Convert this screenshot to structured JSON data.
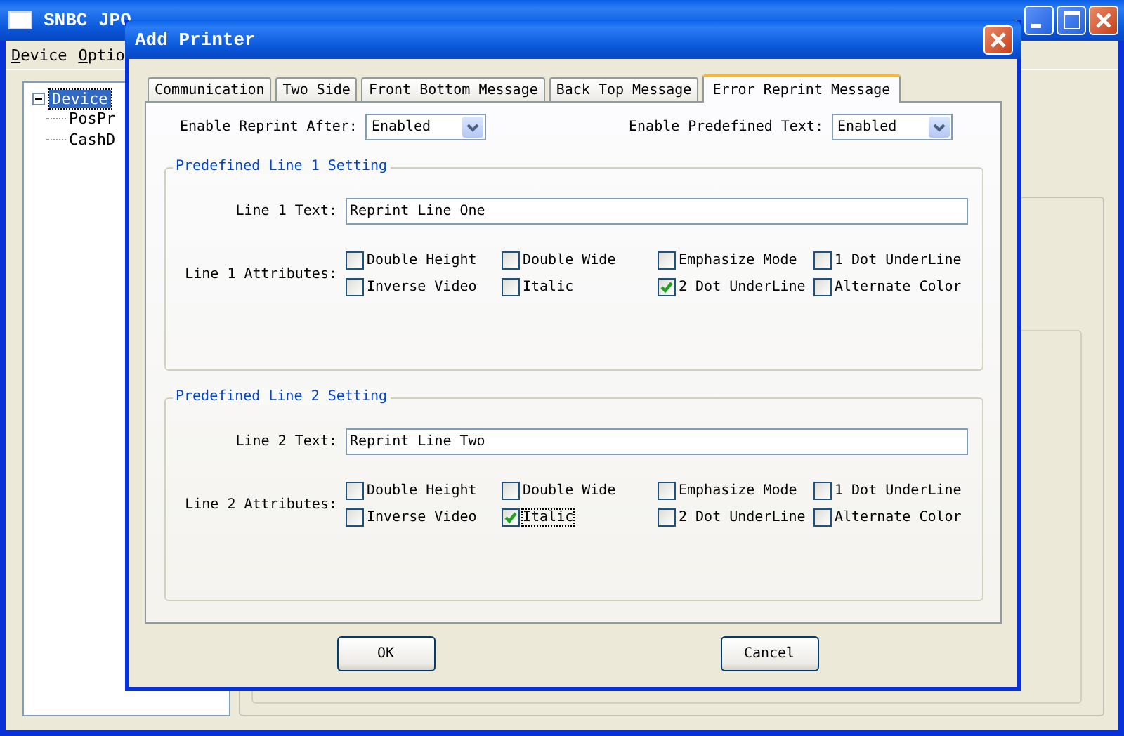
{
  "main_window": {
    "title": "SNBC JPO",
    "menu": [
      "Device",
      "Optio"
    ],
    "tree": [
      {
        "label": "Device",
        "selected": true,
        "expanded": true,
        "children": [
          {
            "label": "PosPr",
            "selected": false
          },
          {
            "label": "CashD",
            "selected": false
          }
        ]
      }
    ]
  },
  "dialog": {
    "title": "Add Printer",
    "tabs": [
      {
        "label": "Communication",
        "selected": false
      },
      {
        "label": "Two Side",
        "selected": false
      },
      {
        "label": "Front Bottom Message",
        "selected": false
      },
      {
        "label": "Back Top Message",
        "selected": false
      },
      {
        "label": "Error Reprint Message",
        "selected": true
      }
    ],
    "enable_reprint_after": {
      "label": "Enable Reprint After:",
      "value": "Enabled"
    },
    "enable_predefined_text": {
      "label": "Enable Predefined Text:",
      "value": "Enabled"
    },
    "groups": [
      {
        "title": "Predefined Line 1 Setting",
        "text_label": "Line 1 Text:",
        "text_value": "Reprint Line One",
        "attributes_label": "Line 1 Attributes:",
        "attributes": [
          {
            "label": "Double Height",
            "checked": false,
            "focused": false
          },
          {
            "label": "Double Wide",
            "checked": false,
            "focused": false
          },
          {
            "label": "Emphasize Mode",
            "checked": false,
            "focused": false
          },
          {
            "label": "1 Dot UnderLine",
            "checked": false,
            "focused": false
          },
          {
            "label": "Inverse Video",
            "checked": false,
            "focused": false
          },
          {
            "label": "Italic",
            "checked": false,
            "focused": false
          },
          {
            "label": "2 Dot UnderLine",
            "checked": true,
            "focused": false
          },
          {
            "label": "Alternate Color",
            "checked": false,
            "focused": false
          }
        ]
      },
      {
        "title": "Predefined Line 2 Setting",
        "text_label": "Line 2 Text:",
        "text_value": "Reprint Line Two",
        "attributes_label": "Line 2 Attributes:",
        "attributes": [
          {
            "label": "Double Height",
            "checked": false,
            "focused": false
          },
          {
            "label": "Double Wide",
            "checked": false,
            "focused": false
          },
          {
            "label": "Emphasize Mode",
            "checked": false,
            "focused": false
          },
          {
            "label": "1 Dot UnderLine",
            "checked": false,
            "focused": false
          },
          {
            "label": "Inverse Video",
            "checked": false,
            "focused": false
          },
          {
            "label": "Italic",
            "checked": true,
            "focused": true
          },
          {
            "label": "2 Dot UnderLine",
            "checked": false,
            "focused": false
          },
          {
            "label": "Alternate Color",
            "checked": false,
            "focused": false
          }
        ]
      }
    ],
    "buttons": [
      "OK",
      "Cancel"
    ]
  }
}
